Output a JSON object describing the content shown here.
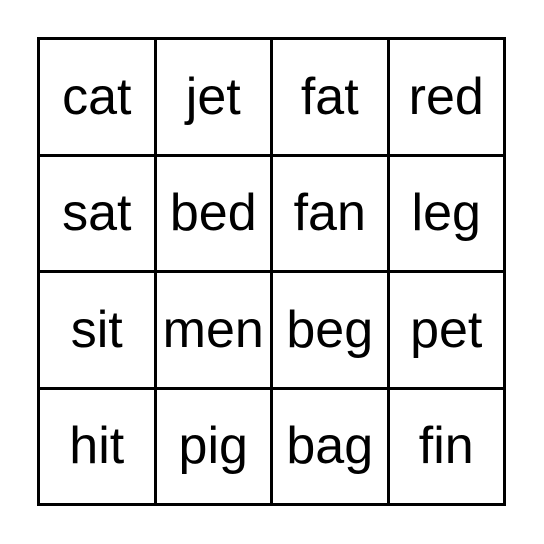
{
  "card": {
    "type": "bingo-card",
    "rows": 4,
    "columns": 4,
    "border_color": "#000000",
    "background_color": "#ffffff",
    "text_color": "#000000",
    "cells": [
      [
        {
          "word": "cat"
        },
        {
          "word": "jet"
        },
        {
          "word": "fat"
        },
        {
          "word": "red"
        }
      ],
      [
        {
          "word": "sat"
        },
        {
          "word": "bed"
        },
        {
          "word": "fan"
        },
        {
          "word": "leg"
        }
      ],
      [
        {
          "word": "sit"
        },
        {
          "word": "men"
        },
        {
          "word": "beg"
        },
        {
          "word": "pet"
        }
      ],
      [
        {
          "word": "hit"
        },
        {
          "word": "pig"
        },
        {
          "word": "bag"
        },
        {
          "word": "fin"
        }
      ]
    ]
  }
}
